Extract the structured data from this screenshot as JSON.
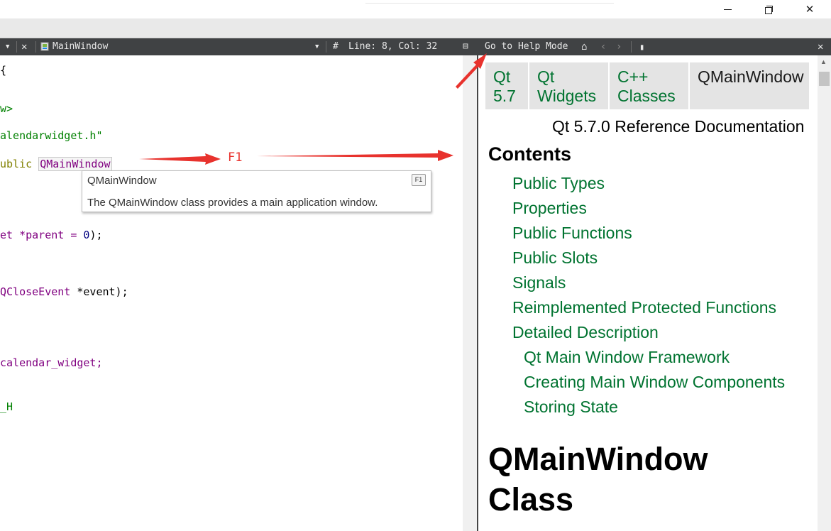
{
  "window": {
    "minimize_icon": "minimize-icon",
    "maximize_icon": "restore-icon",
    "close_icon": "close-icon"
  },
  "editor_toolbar": {
    "file_name": "MainWindow",
    "line_col": "Line: 8, Col: 32",
    "hash": "#"
  },
  "help_toolbar": {
    "go_to_help_mode": "Go to Help Mode"
  },
  "code": {
    "lines": [
      "{",
      "w>",
      "alendarwidget.h\"",
      "ublic ",
      "QMainWindow",
      "et *parent = ",
      "0",
      ");",
      "QCloseEvent",
      " *event);",
      "calendar_widget;",
      "_H"
    ]
  },
  "tooltip": {
    "title": "QMainWindow",
    "key": "F1",
    "description": "The QMainWindow class provides a main application window."
  },
  "annotation": {
    "label": "F1",
    "color": "#e8322d"
  },
  "help": {
    "nav": [
      {
        "line1": "Qt",
        "line2": "5.7"
      },
      {
        "line1": "Qt",
        "line2": "Widgets"
      },
      {
        "line1": "C++",
        "line2": "Classes"
      },
      {
        "line1": "QMainWindow",
        "line2": ""
      }
    ],
    "ref_doc": "Qt 5.7.0 Reference Documentation",
    "contents_heading": "Contents",
    "toc": [
      "Public Types",
      "Properties",
      "Public Functions",
      "Public Slots",
      "Signals",
      "Reimplemented Protected Functions",
      "Detailed Description",
      "Qt Main Window Framework",
      "Creating Main Window Components",
      "Storing State"
    ],
    "page_title_line1": "QMainWindow",
    "page_title_line2": "Class",
    "link_color": "#007330"
  }
}
